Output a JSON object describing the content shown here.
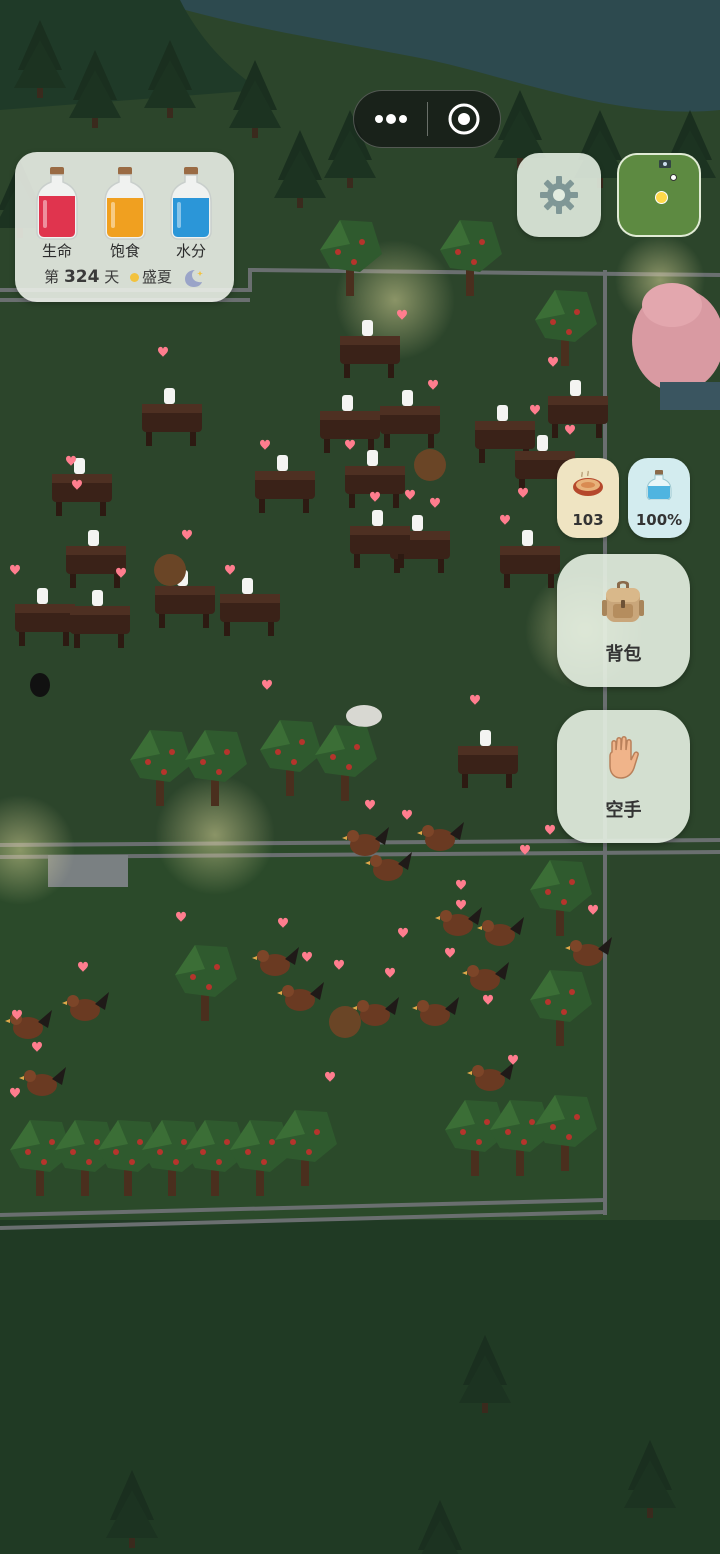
{
  "capsule": {
    "more_icon": "more-dots-icon",
    "close_icon": "target-circle-icon"
  },
  "status_panel": {
    "bottles": [
      {
        "label": "生命",
        "color": "#e0344e",
        "fill": 0.75
      },
      {
        "label": "饱食",
        "color": "#f0a020",
        "fill": 0.7
      },
      {
        "label": "水分",
        "color": "#2b96d8",
        "fill": 0.7
      }
    ],
    "day_prefix": "第",
    "day_number": "324",
    "day_suffix": "天",
    "season": "盛夏",
    "time_icon": "moon-icon"
  },
  "settings": {
    "icon": "gear-icon"
  },
  "minimap": {
    "icon": "minimap-icon"
  },
  "resources": [
    {
      "icon": "food-bowl-icon",
      "value": "103",
      "bg": "#efe4c2"
    },
    {
      "icon": "water-bottle-icon",
      "value": "100%",
      "bg": "#d3ecef"
    }
  ],
  "buttons": {
    "backpack": {
      "label": "背包",
      "icon": "backpack-icon"
    },
    "hand": {
      "label": "空手",
      "icon": "hand-icon"
    }
  },
  "colors": {
    "heart": "#ff7d8e",
    "grass": "#2e4a2d",
    "water": "#2d4a4f"
  }
}
